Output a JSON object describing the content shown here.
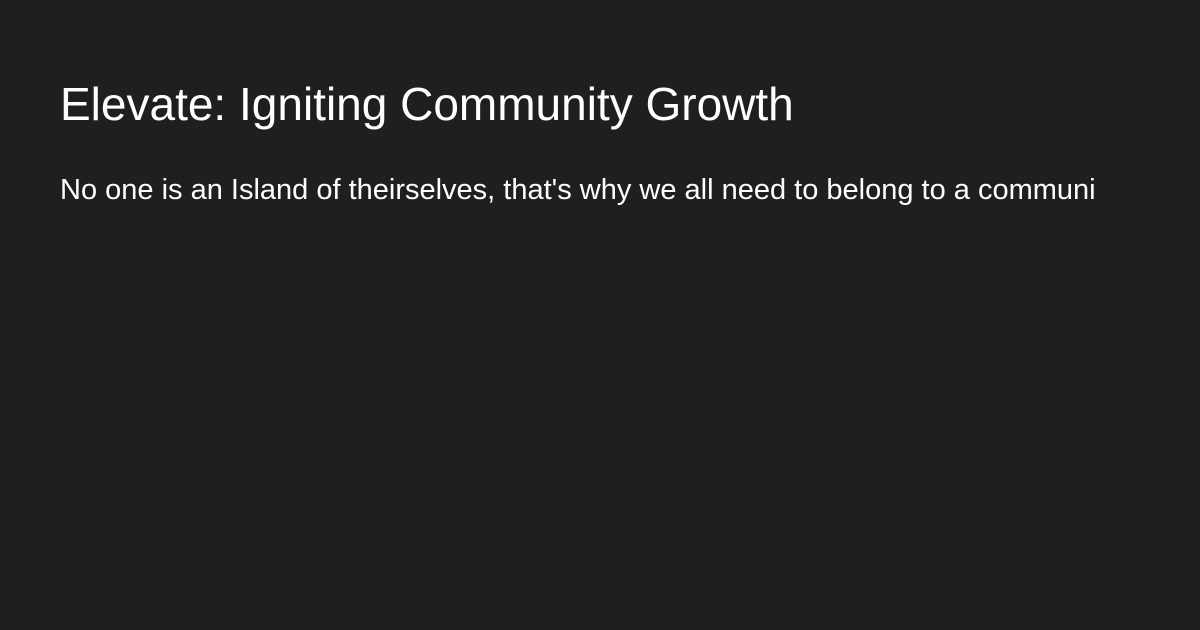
{
  "card": {
    "title": "Elevate: Igniting Community Growth",
    "description": "No one is an Island of theirselves, that's why we all need to belong to a communi"
  },
  "colors": {
    "background": "#1f1f1f",
    "text": "#ffffff"
  }
}
